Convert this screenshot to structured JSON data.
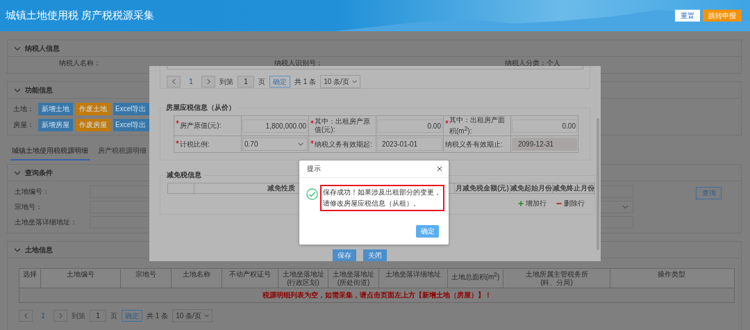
{
  "header": {
    "title": "城镇土地使用税 房产税税源采集",
    "buttons": [
      {
        "label": "重置",
        "kind": "secondary"
      },
      {
        "label": "跳转申报",
        "kind": "primary"
      }
    ]
  },
  "taxpayer_section": {
    "title": "纳税人信息",
    "fields": [
      {
        "label": "纳税人名称："
      },
      {
        "label": "纳税人识别号："
      },
      {
        "label": "纳税人分类：",
        "value": "个人"
      }
    ]
  },
  "function_section": {
    "title": "功能信息",
    "rows": [
      {
        "label": "土地：",
        "buttons": [
          {
            "label": "新增土地",
            "kind": "add"
          },
          {
            "label": "作废土地",
            "kind": "void"
          },
          {
            "label": "Excel导出",
            "kind": "export"
          }
        ]
      },
      {
        "label": "房屋：",
        "buttons": [
          {
            "label": "新增房屋",
            "kind": "add"
          },
          {
            "label": "作废房屋",
            "kind": "void"
          },
          {
            "label": "Excel导出",
            "kind": "export"
          }
        ]
      }
    ]
  },
  "tabs": [
    {
      "label": "城镇土地使用税税源明细",
      "selected": true
    },
    {
      "label": "房产税税源明细",
      "selected": false
    }
  ],
  "query_section": {
    "title": "查询条件",
    "fields": [
      {
        "label": "土地编号：",
        "kind": "input"
      },
      {
        "label": "宗地号：",
        "kind": "select"
      },
      {
        "label": "土地坐落详细地址：",
        "kind": "input"
      }
    ],
    "button": "查询"
  },
  "land_section": {
    "title": "土地信息",
    "table": {
      "columns": [
        {
          "label": "选择"
        },
        {
          "label": "土地编号"
        },
        {
          "label": "宗地号"
        },
        {
          "label": "土地名称"
        },
        {
          "label": "不动产权证号"
        },
        {
          "label": "土地坐落地址",
          "sublabel": "(行政区划)"
        },
        {
          "label": "土地坐落地址",
          "sublabel": "(所处街道)"
        },
        {
          "label": "土地坐落详细地址"
        },
        {
          "label": "土地总面积(m$^{2}$)"
        },
        {
          "label": "土地所属主管税务所",
          "sublabel": "(科、分局)"
        },
        {
          "label": "操作类型"
        }
      ],
      "empty_message": "税源明细列表为空，如需采集，请点击页面左上方【新增土地（房屋）】！"
    },
    "pagination": {
      "current": "1",
      "goto_label": "到第",
      "goto_value": "1",
      "page_unit": "页",
      "confirm": "确定",
      "total": "共 1 条",
      "page_size": "10 条/页"
    }
  },
  "modal": {
    "pagination": {
      "current": "1",
      "goto_label": "到第",
      "goto_value": "1",
      "page_unit": "页",
      "confirm": "确定",
      "total": "共 1 条",
      "page_size": "10 条/页"
    },
    "house_info": {
      "title": "房屋应税信息（从价）",
      "fields": [
        {
          "label": "房产原值(元):",
          "required": true,
          "kind": "number",
          "value": "1,800,000.00"
        },
        {
          "label": "其中：出租房产原值(元):",
          "required": true,
          "kind": "number",
          "value": "0.00"
        },
        {
          "label": "其中：出租房产面积(m$^{2}$):",
          "required": true,
          "kind": "number",
          "value": "0.00"
        },
        {
          "label": "计税比例:",
          "required": true,
          "kind": "select",
          "value": "0.70"
        },
        {
          "label": "纳税义务有效期起:",
          "required": true,
          "kind": "date",
          "value": "2023-01-01"
        },
        {
          "label": "纳税义务有效期止:",
          "required": false,
          "kind": "readonly",
          "value": "2099-12-31"
        }
      ]
    },
    "relief_info": {
      "title": "减免税信息",
      "columns": [
        "减免性质",
        "月减免税金额(元)",
        "减免起始月份",
        "减免终止月份"
      ],
      "add_row": "增加行",
      "delete_row": "删除行"
    },
    "buttons": [
      "保存",
      "关闭"
    ]
  },
  "alert": {
    "title": "提示",
    "message": "保存成功！如果涉及出租部分的变更，请修改房屋应税信息（从租）。",
    "highlighted": true,
    "confirm": "确定"
  }
}
